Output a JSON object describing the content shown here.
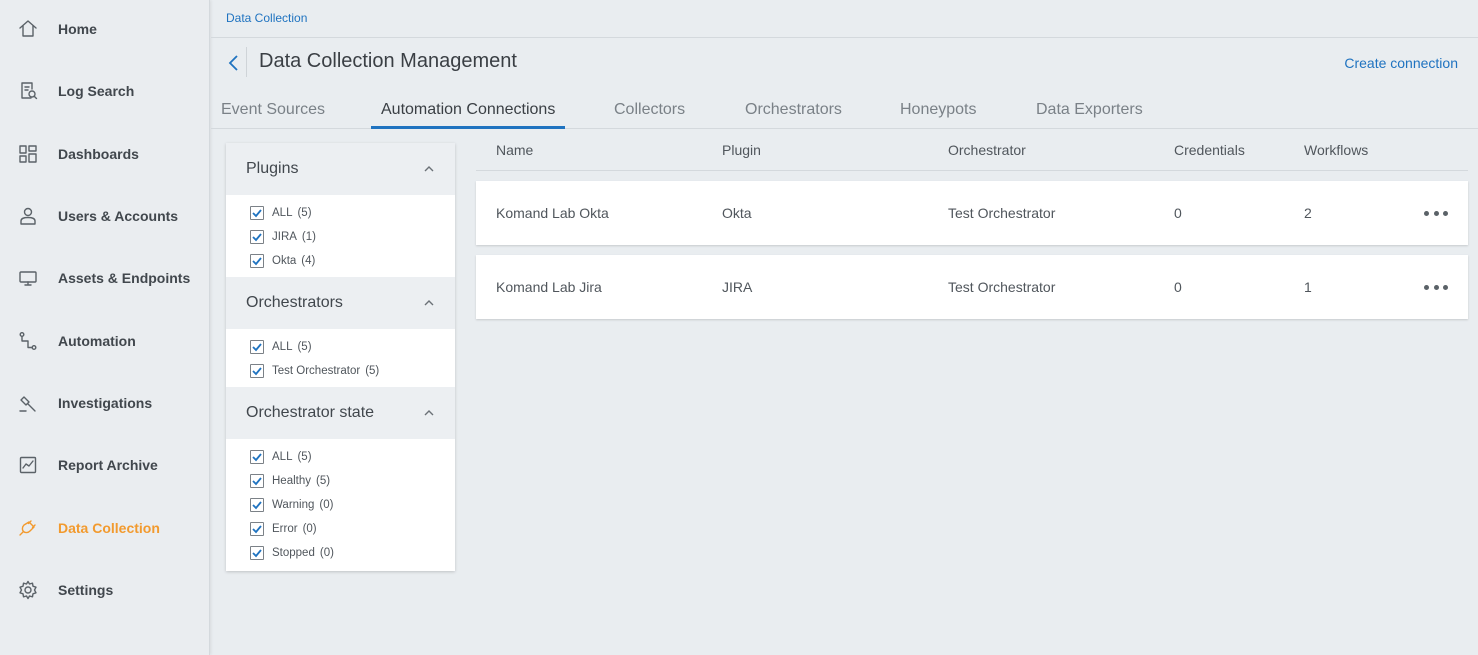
{
  "sidebar": {
    "items": [
      {
        "label": "Home",
        "icon": "home-icon"
      },
      {
        "label": "Log Search",
        "icon": "log-search-icon"
      },
      {
        "label": "Dashboards",
        "icon": "dashboards-icon"
      },
      {
        "label": "Users & Accounts",
        "icon": "user-icon"
      },
      {
        "label": "Assets & Endpoints",
        "icon": "monitor-icon"
      },
      {
        "label": "Automation",
        "icon": "automation-icon"
      },
      {
        "label": "Investigations",
        "icon": "gavel-icon"
      },
      {
        "label": "Report Archive",
        "icon": "report-icon"
      },
      {
        "label": "Data Collection",
        "icon": "plug-icon",
        "active": true
      },
      {
        "label": "Settings",
        "icon": "gear-icon"
      }
    ]
  },
  "breadcrumb": "Data Collection",
  "header": {
    "title": "Data Collection Management",
    "create_link": "Create connection"
  },
  "tabs": [
    {
      "label": "Event Sources"
    },
    {
      "label": "Automation Connections",
      "active": true
    },
    {
      "label": "Collectors"
    },
    {
      "label": "Orchestrators"
    },
    {
      "label": "Honeypots"
    },
    {
      "label": "Data Exporters"
    }
  ],
  "filters": {
    "groups": [
      {
        "title": "Plugins",
        "options": [
          {
            "label": "ALL",
            "count": "(5)",
            "checked": true
          },
          {
            "label": "JIRA",
            "count": "(1)",
            "checked": true
          },
          {
            "label": "Okta",
            "count": "(4)",
            "checked": true
          }
        ]
      },
      {
        "title": "Orchestrators",
        "options": [
          {
            "label": "ALL",
            "count": "(5)",
            "checked": true
          },
          {
            "label": "Test Orchestrator",
            "count": "(5)",
            "checked": true
          }
        ]
      },
      {
        "title": "Orchestrator state",
        "options": [
          {
            "label": "ALL",
            "count": "(5)",
            "checked": true
          },
          {
            "label": "Healthy",
            "count": "(5)",
            "checked": true
          },
          {
            "label": "Warning",
            "count": "(0)",
            "checked": true
          },
          {
            "label": "Error",
            "count": "(0)",
            "checked": true
          },
          {
            "label": "Stopped",
            "count": "(0)",
            "checked": true
          }
        ]
      }
    ]
  },
  "table": {
    "columns": [
      "Name",
      "Plugin",
      "Orchestrator",
      "Credentials",
      "Workflows"
    ],
    "rows": [
      {
        "name": "Komand Lab Okta",
        "plugin": "Okta",
        "orchestrator": "Test Orchestrator",
        "credentials": "0",
        "workflows": "2"
      },
      {
        "name": "Komand Lab Jira",
        "plugin": "JIRA",
        "orchestrator": "Test Orchestrator",
        "credentials": "0",
        "workflows": "1"
      }
    ]
  },
  "colors": {
    "accent": "#1f73c0",
    "active_nav": "#f29a2e",
    "background": "#e9edf0"
  }
}
